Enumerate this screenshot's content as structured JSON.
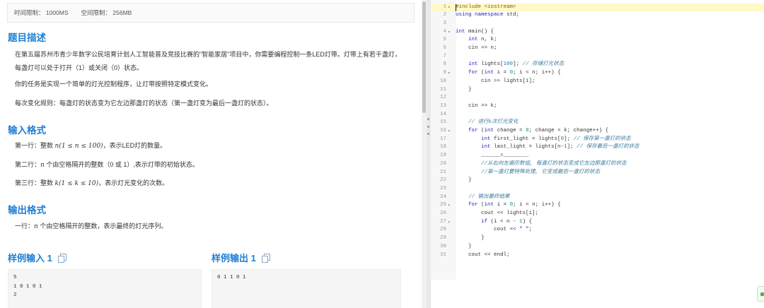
{
  "limits": {
    "time": "时间限制：  1000MS",
    "memory": "空间限制：  256MB"
  },
  "description": {
    "title": "题目描述",
    "p1": "在第五届苏州市青少年数字公民培育计划人工智能普及竞技比赛的\"智能家居\"项目中，你需要编程控制一条LED灯带。灯带上有若干盏灯，每盏灯可以处于打开（1）或关闭（0）状态。",
    "p2": "你的任务是实现一个简单的灯光控制程序，让灯带按照特定模式变化。",
    "p3": "每次变化规则：每盏灯的状态变为它左边那盏灯的状态（第一盏灯变为最后一盏灯的状态）。"
  },
  "input": {
    "title": "输入格式",
    "l1_pre": "第一行：整数 ",
    "l1_math": "n(1 ≤ n ≤ 100)",
    "l1_post": "，表示LED灯的数量。",
    "l2_pre": "第二行：",
    "l2_math": "n",
    "l2_post": " 个由空格隔开的整数（0 或 1）,表示灯带的初始状态。",
    "l3_pre": "第三行：整数 ",
    "l3_math": "k(1 ≤ k ≤ 10)",
    "l3_post": "，表示灯光变化的次数。"
  },
  "output": {
    "title": "输出格式",
    "l1_pre": "一行：",
    "l1_math": "n",
    "l1_post": " 个由空格隔开的整数，表示最终的灯光序列。"
  },
  "samples": {
    "input_title": "样例输入 1",
    "input_text": "5\n1 0 1 0 1\n2",
    "output_title": "样例输出 1",
    "output_text": "0 1 1 0 1"
  },
  "code": {
    "lines": [
      {
        "n": "1",
        "fold": true,
        "html": "<span class='pp'>#include &lt;iostream&gt;</span>"
      },
      {
        "n": "2",
        "html": "<span class='kw'>using namespace</span> std;"
      },
      {
        "n": "3",
        "html": ""
      },
      {
        "n": "4",
        "fold": true,
        "html": "<span class='kw'>int</span> main() {"
      },
      {
        "n": "5",
        "html": "    <span class='kw'>int</span> n, k;"
      },
      {
        "n": "6",
        "html": "    cin &gt;&gt; n;"
      },
      {
        "n": "7",
        "html": ""
      },
      {
        "n": "8",
        "html": "    <span class='kw'>int</span> lights[<span class='num'>100</span>]; <span class='cm'>// 存储灯光状态</span>"
      },
      {
        "n": "9",
        "fold": true,
        "html": "    <span class='kw'>for</span> (<span class='kw'>int</span> i = <span class='num'>0</span>; i &lt; n; i++) {"
      },
      {
        "n": "10",
        "html": "        cin &gt;&gt; lights[i];"
      },
      {
        "n": "11",
        "html": "    }"
      },
      {
        "n": "12",
        "html": ""
      },
      {
        "n": "13",
        "html": "    cin &gt;&gt; k;"
      },
      {
        "n": "14",
        "html": ""
      },
      {
        "n": "15",
        "html": "    <span class='cm'>// 进行k次灯光变化</span>"
      },
      {
        "n": "16",
        "fold": true,
        "html": "    <span class='kw'>for</span> (<span class='kw'>int</span> change = <span class='num'>0</span>; change &lt; k; change++) {"
      },
      {
        "n": "17",
        "html": "        <span class='kw'>int</span> first_light = lights[<span class='num'>0</span>]; <span class='cm'>// 保存第一盏灯的状态</span>"
      },
      {
        "n": "18",
        "html": "        <span class='kw'>int</span> last_light = lights[n-<span class='num'>1</span>]; <span class='cm'>// 保存最后一盏灯的状态</span>"
      },
      {
        "n": "19",
        "html": "        ______<span class='cm'>s</span>________"
      },
      {
        "n": "20",
        "html": "        <span class='cm'>//从右向左遍历数组, 每盏灯的状态变成它左边那盏灯的状态</span>"
      },
      {
        "n": "21",
        "html": "        <span class='cm'>//第一盏灯要特殊处理, 它变成最后一盏灯的状态</span>"
      },
      {
        "n": "22",
        "html": "    }"
      },
      {
        "n": "23",
        "html": ""
      },
      {
        "n": "24",
        "html": "    <span class='cm'>// 输出最终结果</span>"
      },
      {
        "n": "25",
        "fold": true,
        "html": "    <span class='kw'>for</span> (<span class='kw'>int</span> i = <span class='num'>0</span>; i &lt; n; i++) {"
      },
      {
        "n": "26",
        "html": "        cout &lt;&lt; lights[i];"
      },
      {
        "n": "27",
        "fold": true,
        "html": "        <span class='kw'>if</span> (i &lt; n - <span class='num'>1</span>) {"
      },
      {
        "n": "28",
        "html": "            cout &lt;&lt; <span class='str'>\" \"</span>;"
      },
      {
        "n": "29",
        "html": "        }"
      },
      {
        "n": "30",
        "html": "    }"
      },
      {
        "n": "31",
        "html": "    cout &lt;&lt; endl;"
      }
    ]
  }
}
